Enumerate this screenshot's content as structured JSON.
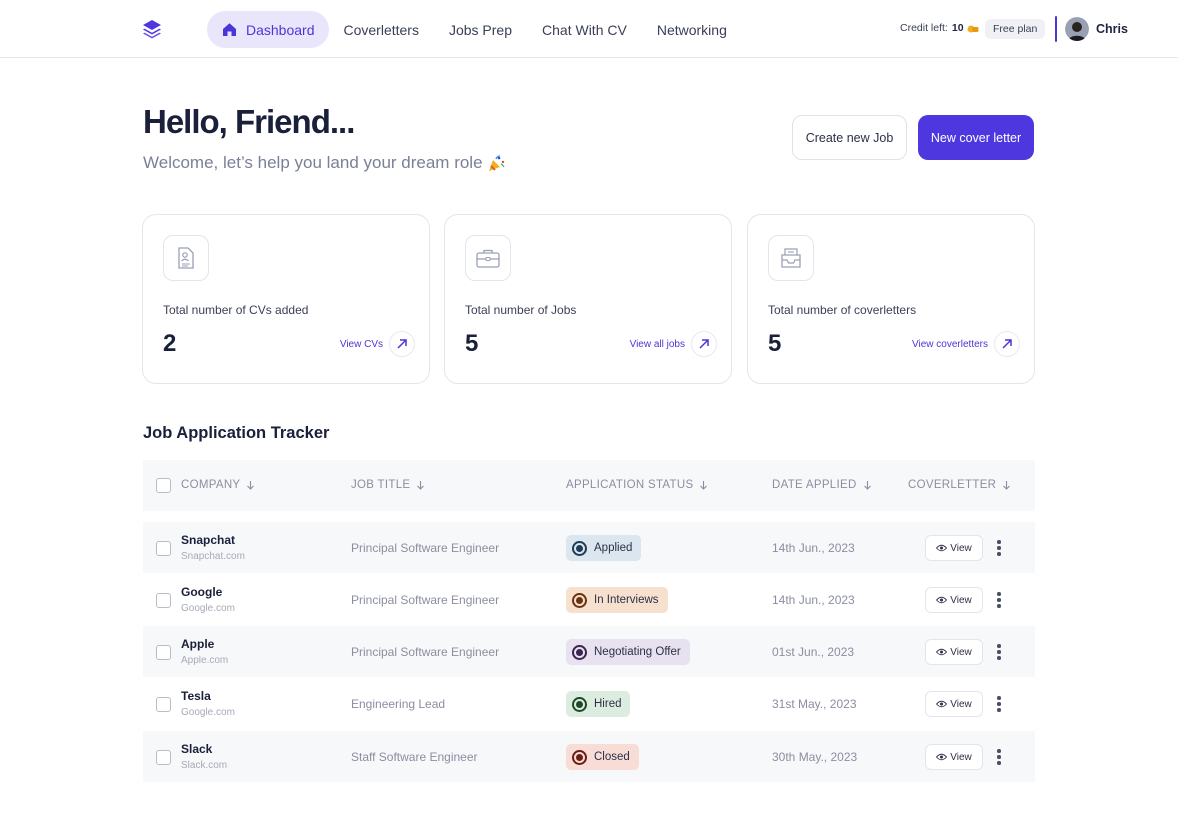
{
  "nav": {
    "items": [
      {
        "label": "Dashboard",
        "icon": "home-icon",
        "active": true
      },
      {
        "label": "Coverletters"
      },
      {
        "label": "Jobs Prep"
      },
      {
        "label": "Chat With CV"
      },
      {
        "label": "Networking"
      }
    ],
    "credit_label": "Credit left:",
    "credit_value": "10",
    "plan": "Free plan",
    "user_name": "Chris"
  },
  "greeting": {
    "title": "Hello, Friend...",
    "subtitle": "Welcome, let’s help you land your dream role",
    "subtitle_icon": "party-popper-icon"
  },
  "actions": {
    "create_job": "Create new Job",
    "new_cover_letter": "New cover letter"
  },
  "stats": [
    {
      "label": "Total number of CVs added",
      "value": "2",
      "link": "View CVs",
      "icon": "cv-document-icon"
    },
    {
      "label": "Total number of Jobs",
      "value": "5",
      "link": "View all jobs",
      "icon": "briefcase-icon"
    },
    {
      "label": "Total number of coverletters",
      "value": "5",
      "link": "View coverletters",
      "icon": "inbox-tray-icon"
    }
  ],
  "tracker": {
    "title": "Job Application Tracker",
    "columns": [
      "COMPANY",
      "JOB TITLE",
      "APPLICATION STATUS",
      "DATE APPLIED",
      "COVERLETTER"
    ],
    "view_label": "View",
    "rows": [
      {
        "company": "Snapchat",
        "domain": "Snapchat.com",
        "job": "Principal Software Engineer",
        "status": "Applied",
        "date": "14th Jun., 2023"
      },
      {
        "company": "Google",
        "domain": "Google.com",
        "job": "Principal Software Engineer",
        "status": "In Interviews",
        "date": "14th Jun., 2023"
      },
      {
        "company": "Apple",
        "domain": "Apple.com",
        "job": "Principal Software Engineer",
        "status": "Negotiating Offer",
        "date": "01st Jun., 2023"
      },
      {
        "company": "Tesla",
        "domain": "Google.com",
        "job": "Engineering Lead",
        "status": "Hired",
        "date": "31st May., 2023"
      },
      {
        "company": "Slack",
        "domain": "Slack.com",
        "job": "Staff Software Engineer",
        "status": "Closed",
        "date": "30th May., 2023"
      }
    ]
  },
  "colors": {
    "accent": "#4f37e0",
    "status_applied_bg": "#dbe6ef",
    "status_applied_dot": "#1f3c56",
    "status_interviews_bg": "#f8e0cf",
    "status_interviews_dot": "#6b3410",
    "status_negotiating_bg": "#e8e2f0",
    "status_negotiating_dot": "#3b2450",
    "status_hired_bg": "#dcede0",
    "status_hired_dot": "#1f4a2a",
    "status_closed_bg": "#f8dcd6",
    "status_closed_dot": "#6b1f14"
  }
}
